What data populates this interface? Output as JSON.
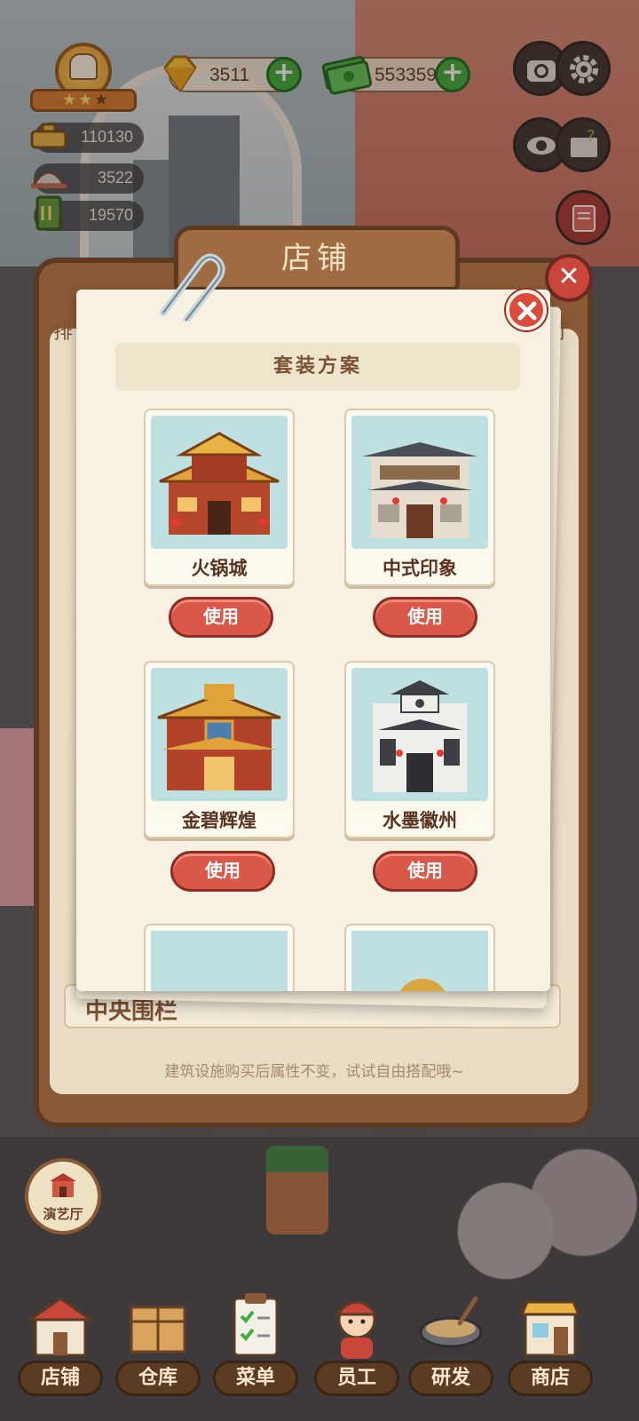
{
  "hud": {
    "gems": "3511",
    "cash": "553359",
    "stat_1": "110130",
    "stat_2": "3522",
    "stat_3": "19570"
  },
  "shop": {
    "title": "店铺",
    "left_tab_partial": "排",
    "right_tab_partial": "厅",
    "row_label": "中央围栏",
    "hint": "建筑设施购买后属性不变，试试自由搭配哦~"
  },
  "popup": {
    "title": "套装方案",
    "cards": [
      {
        "name": "火锅城",
        "button": "使用"
      },
      {
        "name": "中式印象",
        "button": "使用"
      },
      {
        "name": "金碧辉煌",
        "button": "使用"
      },
      {
        "name": "水墨徽州",
        "button": "使用"
      }
    ]
  },
  "side": {
    "theater_label": "演艺厅"
  },
  "nav": {
    "items": [
      {
        "label": "店铺"
      },
      {
        "label": "仓库"
      },
      {
        "label": "菜单"
      },
      {
        "label": "员工"
      },
      {
        "label": "研发"
      },
      {
        "label": "商店"
      }
    ]
  },
  "colors": {
    "board_brown": "#8a5a37",
    "paper": "#f8f1e2",
    "use_button_red": "#d9584a",
    "plus_green": "#3fae3c"
  }
}
